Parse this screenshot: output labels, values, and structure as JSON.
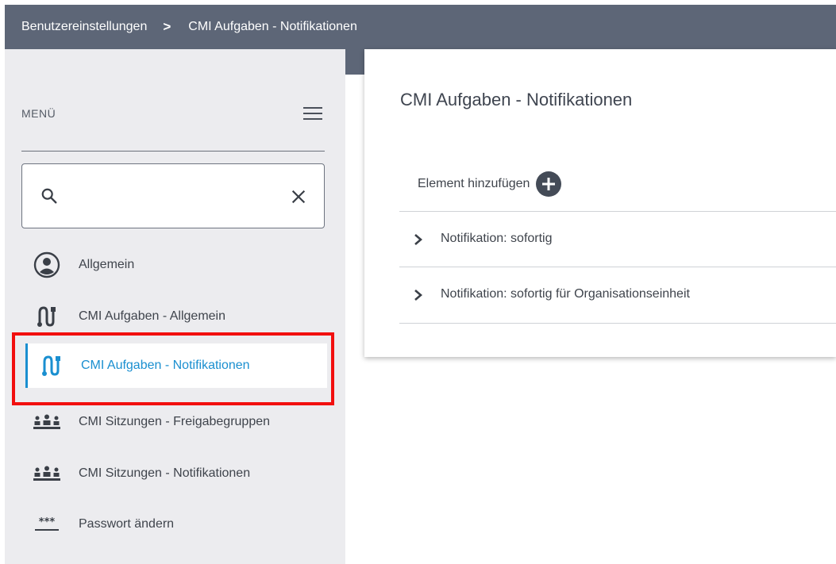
{
  "header": {
    "breadcrumb": [
      {
        "label": "Benutzereinstellungen"
      },
      {
        "label": "CMI Aufgaben - Notifikationen"
      }
    ],
    "separator": ">"
  },
  "sidebar": {
    "menu_title": "MENÜ",
    "search": {
      "value": "",
      "placeholder": ""
    },
    "items": [
      {
        "label": "Allgemein",
        "icon": "user-circle-icon",
        "active": false
      },
      {
        "label": "CMI Aufgaben - Allgemein",
        "icon": "task-flow-icon",
        "active": false
      },
      {
        "label": "CMI Aufgaben - Notifikationen",
        "icon": "task-flow-icon",
        "active": true
      },
      {
        "label": "CMI Sitzungen - Freigabegruppen",
        "icon": "meeting-group-icon",
        "active": false
      },
      {
        "label": "CMI Sitzungen - Notifikationen",
        "icon": "meeting-group-icon",
        "active": false
      },
      {
        "label": "Passwort ändern",
        "icon": "password-icon",
        "active": false
      }
    ]
  },
  "main": {
    "title": "CMI Aufgaben - Notifikationen",
    "add_label": "Element hinzufügen",
    "accordion": [
      {
        "label": "Notifikation: sofortig"
      },
      {
        "label": "Notifikation: sofortig für Organisationseinheit"
      }
    ]
  },
  "colors": {
    "header_bg": "#5d6677",
    "accent": "#1a8fd0",
    "highlight": "#f20f0f",
    "sidebar_bg": "#ececef"
  }
}
